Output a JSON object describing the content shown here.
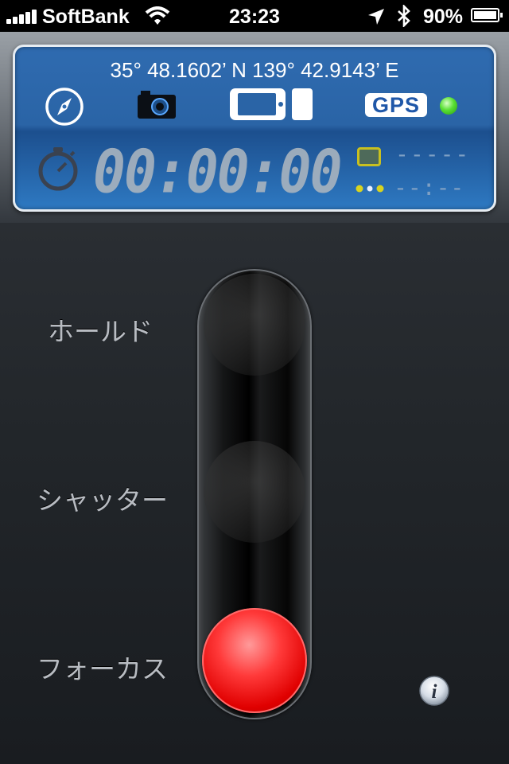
{
  "status_bar": {
    "carrier": "SoftBank",
    "time": "23:23",
    "battery_percent": "90%",
    "battery_level": 0.9,
    "signal_bars": 5
  },
  "panel": {
    "coordinates": "35° 48.1602’ N 139° 42.9143’ E",
    "gps_label": "GPS",
    "gps_status_color": "#47d62a",
    "timer": "00:00:00",
    "frame_count": "-----",
    "elapsed": "--:--",
    "icons": [
      "compass-icon",
      "camera-icon",
      "phone-landscape-icon",
      "stopwatch-icon",
      "frame-icon",
      "dots-icon"
    ]
  },
  "slider": {
    "labels": {
      "hold": "ホールド",
      "shutter": "シャッター",
      "focus": "フォーカス"
    },
    "knob_color": "#e00000"
  },
  "info_button": {
    "icon": "info-icon",
    "label": "i"
  }
}
